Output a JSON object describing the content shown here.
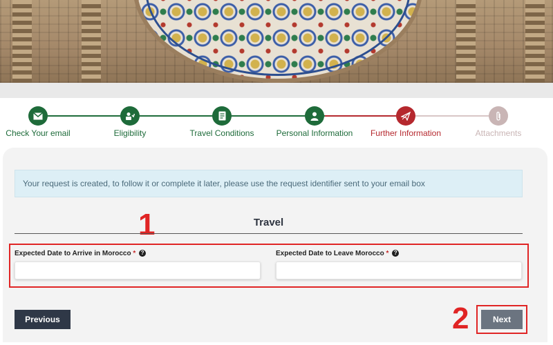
{
  "steps": [
    {
      "label": "Check Your email",
      "icon": "envelope-icon",
      "status": "done"
    },
    {
      "label": "Eligibility",
      "icon": "eligibility-icon",
      "status": "done"
    },
    {
      "label": "Travel Conditions",
      "icon": "document-icon",
      "status": "done"
    },
    {
      "label": "Personal Information",
      "icon": "person-icon",
      "status": "done"
    },
    {
      "label": "Further Information",
      "icon": "plane-icon",
      "status": "current"
    },
    {
      "label": "Attachments",
      "icon": "paperclip-icon",
      "status": "pending"
    }
  ],
  "colors": {
    "done": "#1e6b3a",
    "current": "#b5282e",
    "pending": "#c9b5b5",
    "annotation": "#e02424",
    "primary_button": "#2f3847",
    "secondary_button": "#6b7480"
  },
  "info_message": "Your request is created, to follow it or complete it later, please use the request identifier sent to your email box",
  "section": {
    "title": "Travel"
  },
  "fields": {
    "arrive": {
      "label": "Expected Date to Arrive in Morocco",
      "required_mark": "*",
      "value": ""
    },
    "leave": {
      "label": "Expected Date to Leave Morocco",
      "required_mark": "*",
      "value": ""
    }
  },
  "annotations": {
    "one": "1",
    "two": "2"
  },
  "buttons": {
    "previous": "Previous",
    "next": "Next"
  }
}
